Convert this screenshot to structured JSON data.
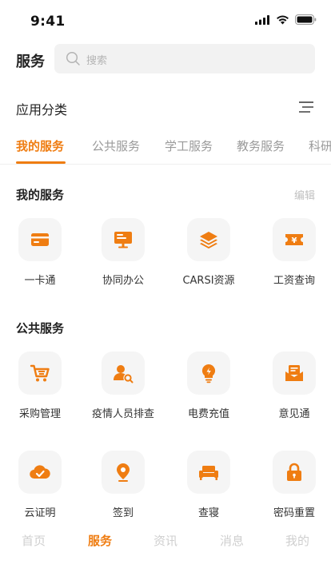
{
  "status_bar": {
    "time": "9:41"
  },
  "header": {
    "title": "服务",
    "search_placeholder": "搜索"
  },
  "category": {
    "title": "应用分类"
  },
  "tabs": [
    "我的服务",
    "公共服务",
    "学工服务",
    "教务服务",
    "科研"
  ],
  "my_services": {
    "title": "我的服务",
    "edit_label": "编辑",
    "items": [
      {
        "label": "一卡通",
        "icon": "card-icon"
      },
      {
        "label": "协同办公",
        "icon": "monitor-icon"
      },
      {
        "label": "CARSI资源",
        "icon": "layers-icon"
      },
      {
        "label": "工资查询",
        "icon": "salary-ticket-icon"
      }
    ]
  },
  "public_services": {
    "title": "公共服务",
    "items": [
      {
        "label": "采购管理",
        "icon": "cart-icon"
      },
      {
        "label": "疫情人员排查",
        "icon": "person-search-icon"
      },
      {
        "label": "电费充值",
        "icon": "lightbulb-icon"
      },
      {
        "label": "意见通",
        "icon": "mail-icon"
      },
      {
        "label": "云证明",
        "icon": "cloud-check-icon"
      },
      {
        "label": "签到",
        "icon": "location-pin-icon"
      },
      {
        "label": "查寝",
        "icon": "bed-icon"
      },
      {
        "label": "密码重置",
        "icon": "lock-icon"
      }
    ]
  },
  "bottom_nav": [
    "首页",
    "服务",
    "资讯",
    "消息",
    "我的"
  ],
  "colors": {
    "accent": "#ef7d12",
    "icon_bg": "#f5f5f5",
    "muted": "#9a9a9a"
  }
}
